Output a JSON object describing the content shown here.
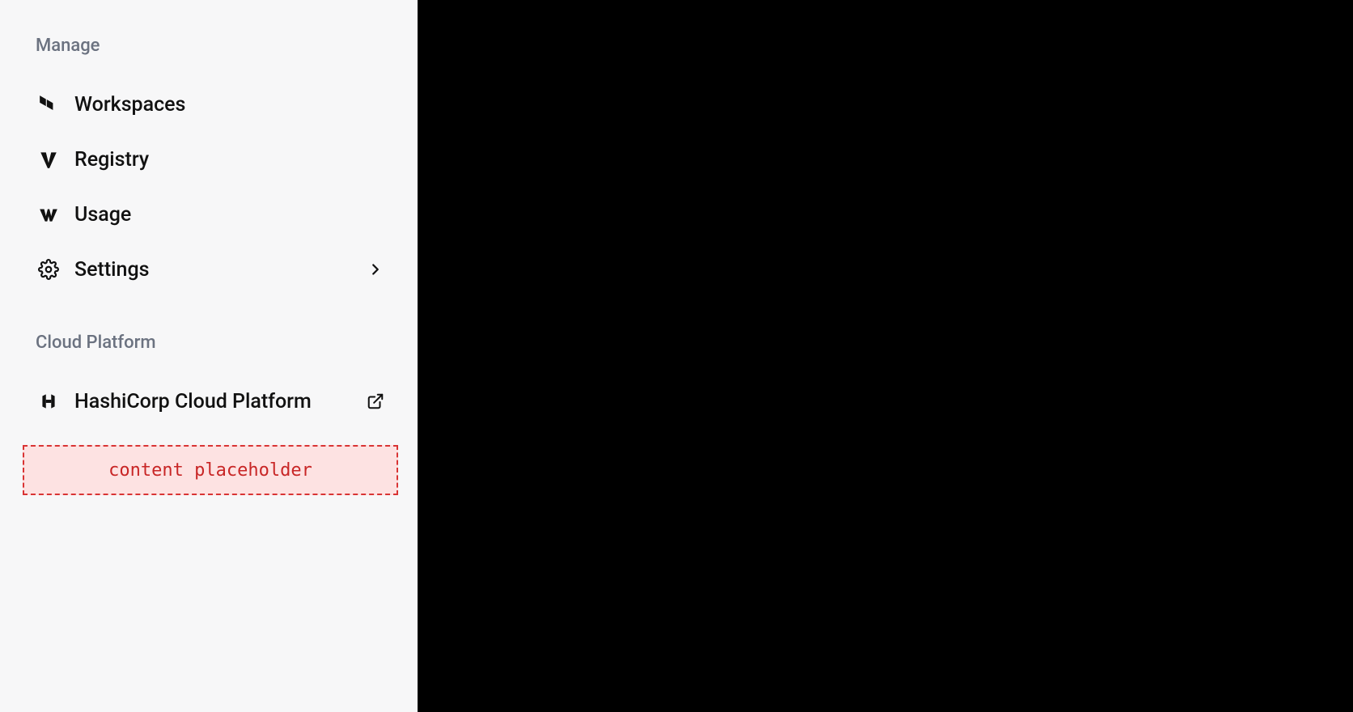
{
  "sidebar": {
    "sections": [
      {
        "title": "Manage",
        "items": [
          {
            "label": "Workspaces",
            "icon": "terraform-icon"
          },
          {
            "label": "Registry",
            "icon": "vagrant-icon"
          },
          {
            "label": "Usage",
            "icon": "waypoint-icon"
          },
          {
            "label": "Settings",
            "icon": "gear-icon",
            "has_submenu": true
          }
        ]
      },
      {
        "title": "Cloud Platform",
        "items": [
          {
            "label": "HashiCorp Cloud Platform",
            "icon": "hashicorp-icon",
            "external": true
          }
        ]
      }
    ],
    "placeholder": "content placeholder"
  }
}
